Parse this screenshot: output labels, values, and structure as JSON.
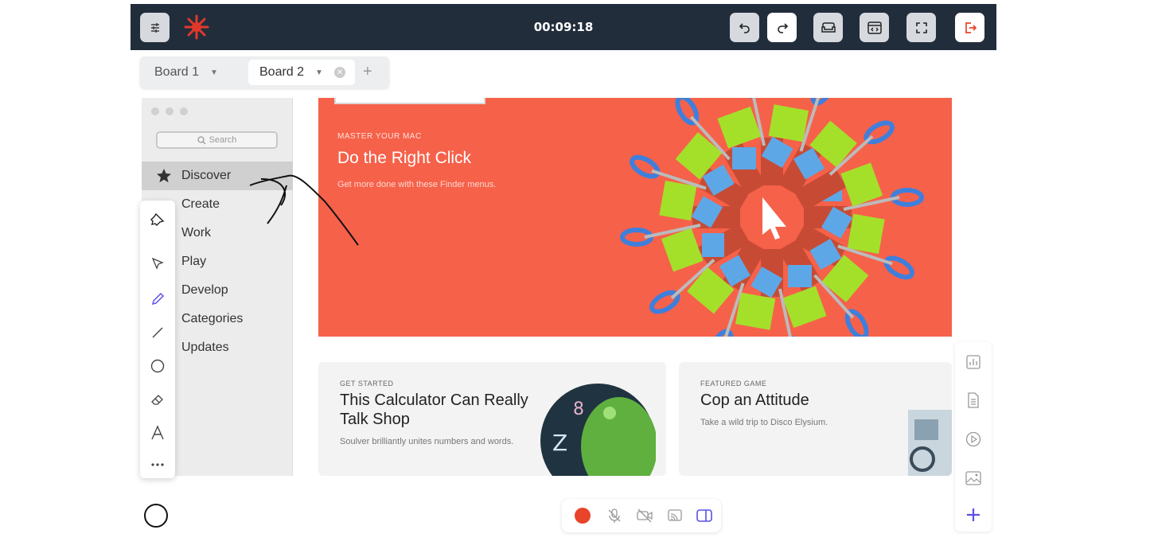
{
  "topbar": {
    "timer": "00:09:18"
  },
  "tabs": [
    {
      "label": "Board 1"
    },
    {
      "label": "Board 2"
    }
  ],
  "mac_sidebar": {
    "search_placeholder": "Search",
    "items": [
      {
        "label": "Discover",
        "icon": "star-icon"
      },
      {
        "label": "Create"
      },
      {
        "label": "Work"
      },
      {
        "label": "Play"
      },
      {
        "label": "Develop"
      },
      {
        "label": "Categories"
      },
      {
        "label": "Updates"
      }
    ]
  },
  "hero": {
    "kicker": "MASTER YOUR MAC",
    "title": "Do the Right Click",
    "subtitle": "Get more done with these Finder menus."
  },
  "cards": [
    {
      "kicker": "GET STARTED",
      "title_line1": "This Calculator Can Really",
      "title_line2": "Talk Shop",
      "subtitle": "Soulver brilliantly unites numbers and words."
    },
    {
      "kicker": "FEATURED GAME",
      "title_line1": "Cop an Attitude",
      "subtitle": "Take a wild trip to Disco Elysium."
    }
  ],
  "colors": {
    "topbar": "#222d3c",
    "hero": "#f6614a",
    "accent": "#5b50e6",
    "record": "#e8442a",
    "exit": "#e8442a"
  }
}
